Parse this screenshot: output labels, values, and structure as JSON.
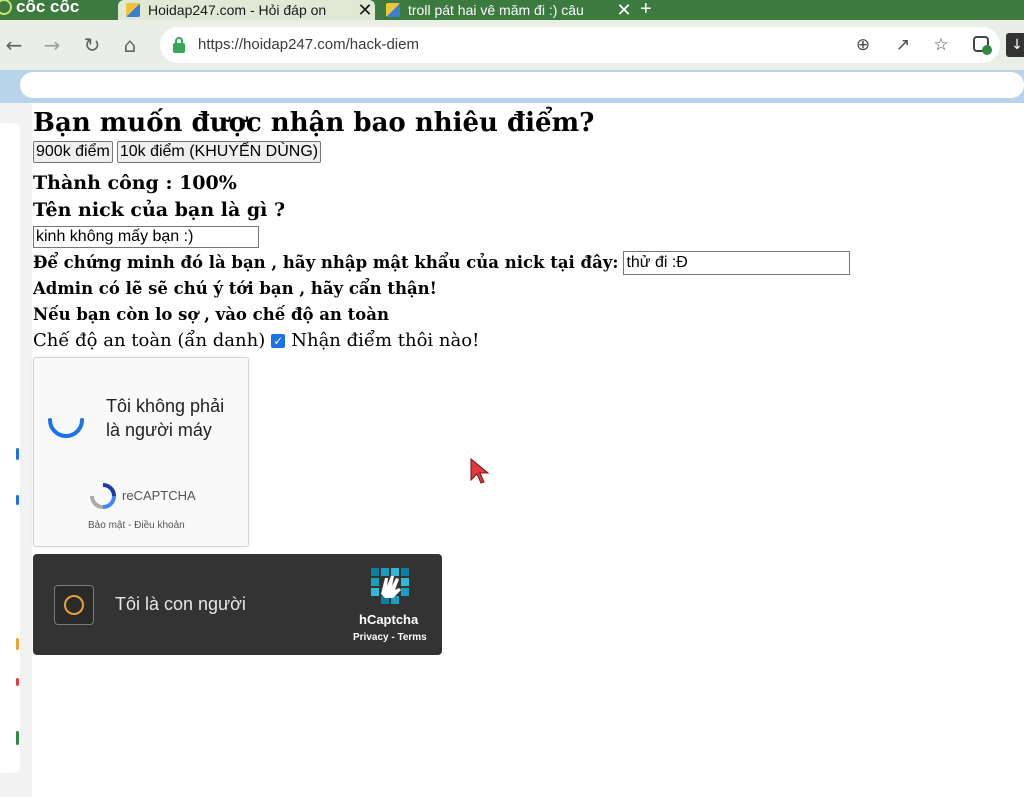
{
  "browser": {
    "brand": "cốc cốc",
    "tabs": [
      {
        "title": "Hoidap247.com - Hỏi đáp on"
      },
      {
        "title": "troll pát hai vê măm đi :) câu"
      }
    ],
    "new_tab": "+",
    "tab_close": "✕",
    "url": "https://hoidap247.com/hack-diem"
  },
  "page": {
    "heading": "Bạn muốn được nhận bao nhiêu điểm?",
    "buttons": [
      "900k điểm",
      "10k điểm (KHUYẾN DÙNG)"
    ],
    "success": "Thành công : 100%",
    "nick_question": "Tên nick của bạn là gì ?",
    "nick_value": "kinh không mấy bạn :)",
    "password_label": "Để chứng minh đó là bạn , hãy nhập mật khẩu của nick tại đây:",
    "password_value": "thử đi :Đ",
    "warning": "Admin có lẽ sẽ chú ý tới bạn , hãy cẩn thận!",
    "safe_hint": "Nếu bạn còn lo sợ , vào chế độ an toàn",
    "safe_mode": "Chế độ an toàn (ẩn danh)",
    "receive": "Nhận điểm thôi nào!"
  },
  "recaptcha": {
    "line1": "Tôi không phải",
    "line2": "là người máy",
    "brand": "reCAPTCHA",
    "terms": "Bảo mật - Điều khoản"
  },
  "hcaptcha": {
    "label": "Tôi là con người",
    "brand": "hCaptcha",
    "terms": "Privacy - Terms"
  },
  "icons": [
    "back-icon",
    "forward-icon",
    "reload-icon",
    "home-icon",
    "lock-icon",
    "zoom-icon",
    "share-icon",
    "star-icon",
    "extension-icon",
    "download-icon",
    "checkbox-checked-icon",
    "recaptcha-spinner-icon",
    "recaptcha-logo-icon",
    "hcaptcha-logo-icon",
    "cursor-icon"
  ],
  "colors": {
    "tabbar": "#3c7a3f",
    "toolbar": "#e9efe5",
    "checkbox": "#1a73e8",
    "hcaptcha_bg": "#333333",
    "spinner": "#1a73e8"
  }
}
